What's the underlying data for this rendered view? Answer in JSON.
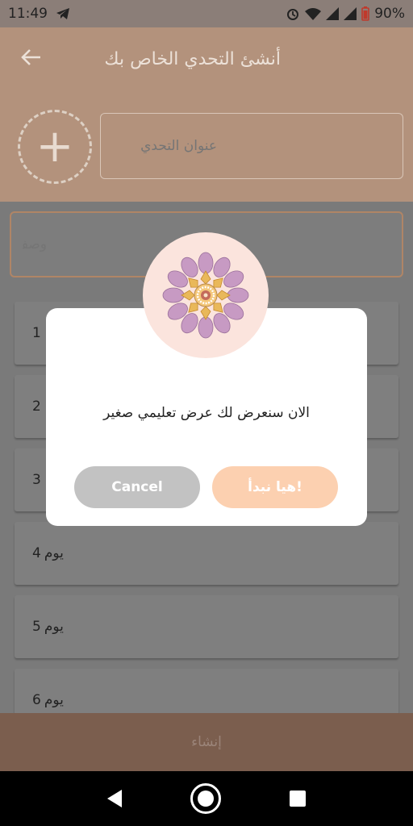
{
  "status_bar": {
    "time": "11:49",
    "battery": "90%"
  },
  "toolbar": {
    "title": "أنشئ التحدي الخاص بك"
  },
  "form": {
    "title_placeholder": "عنوان التحدي",
    "description_placeholder": "وصف"
  },
  "days": [
    {
      "number": "1",
      "label": ""
    },
    {
      "number": "2",
      "label": ""
    },
    {
      "number": "3",
      "label": ""
    },
    {
      "number": "4",
      "label": "يوم"
    },
    {
      "number": "5",
      "label": "يوم"
    },
    {
      "number": "6",
      "label": "يوم"
    }
  ],
  "bottom_bar": {
    "create_label": "إنشاء"
  },
  "dialog": {
    "message": "الان سنعرض لك عرض تعليمي صغير",
    "cancel_label": "Cancel",
    "start_label": "!هيا نبدأ"
  },
  "colors": {
    "header": "#b3927c",
    "accent": "#fcd0b0",
    "bottom_bar": "#7b5e4e"
  },
  "icons": [
    "telegram-icon",
    "alarm-icon",
    "wifi-icon",
    "signal-icon",
    "battery-icon",
    "back-arrow-icon",
    "add-icon",
    "mandala-icon"
  ]
}
